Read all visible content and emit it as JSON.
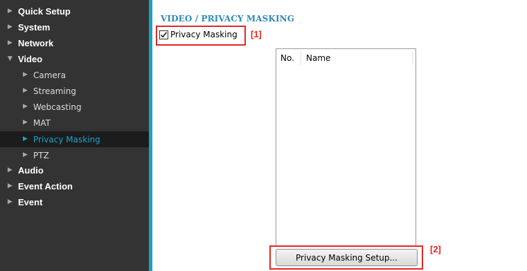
{
  "sidebar": {
    "items": [
      {
        "label": "Quick Setup",
        "level": "top",
        "icon": "triangle-right-icon"
      },
      {
        "label": "System",
        "level": "top",
        "icon": "triangle-right-icon"
      },
      {
        "label": "Network",
        "level": "top",
        "icon": "triangle-right-icon"
      },
      {
        "label": "Video",
        "level": "top",
        "icon": "triangle-down-icon",
        "expanded": true
      },
      {
        "label": "Camera",
        "level": "sub",
        "icon": "triangle-right-icon"
      },
      {
        "label": "Streaming",
        "level": "sub",
        "icon": "triangle-right-icon"
      },
      {
        "label": "Webcasting",
        "level": "sub",
        "icon": "triangle-right-icon"
      },
      {
        "label": "MAT",
        "level": "sub",
        "icon": "triangle-right-icon"
      },
      {
        "label": "Privacy Masking",
        "level": "sub",
        "icon": "triangle-right-icon",
        "active": true
      },
      {
        "label": "PTZ",
        "level": "sub",
        "icon": "triangle-right-icon"
      },
      {
        "label": "Audio",
        "level": "top",
        "icon": "triangle-right-icon"
      },
      {
        "label": "Event Action",
        "level": "top",
        "icon": "triangle-right-icon"
      },
      {
        "label": "Event",
        "level": "top",
        "icon": "triangle-right-icon"
      }
    ]
  },
  "main": {
    "title": "VIDEO / PRIVACY MASKING",
    "privacy_masking": {
      "label": "Privacy Masking",
      "checked": true
    },
    "mask_list": {
      "columns": [
        "No.",
        "Name"
      ],
      "rows": []
    },
    "setup_button_label": "Privacy Masking Setup..."
  },
  "callouts": {
    "first": "[1]",
    "second": "[2]"
  },
  "colors": {
    "sidebar_bg": "#333333",
    "accent": "#1aa3c2",
    "title": "#2d8ab4",
    "callout": "#e0261f",
    "active_item": "#18a6c8"
  }
}
